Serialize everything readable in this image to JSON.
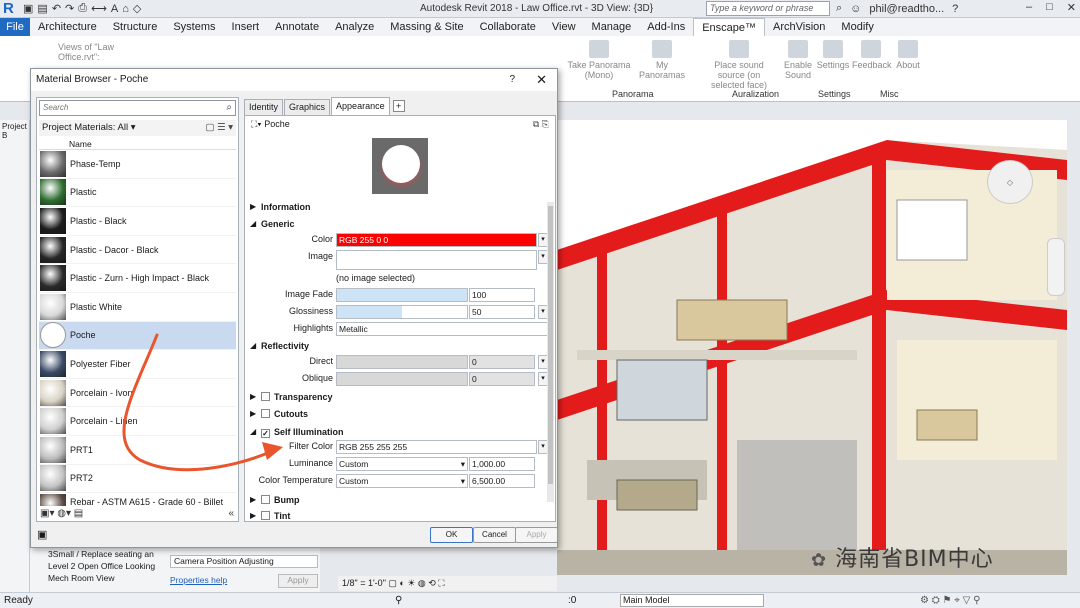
{
  "titlebar": {
    "window_title": "Autodesk Revit 2018 -    Law Office.rvt - 3D View: {3D}",
    "search_placeholder": "Type a keyword or phrase",
    "user": "phil@readtho..."
  },
  "ribbon_tabs": [
    "File",
    "Architecture",
    "Structure",
    "Systems",
    "Insert",
    "Annotate",
    "Analyze",
    "Massing & Site",
    "Collaborate",
    "View",
    "Manage",
    "Add-Ins",
    "Enscape™",
    "ArchVision",
    "Modify"
  ],
  "ribbon": {
    "views_label": "Views of \"Law Office.rvt\":",
    "buttons": [
      "Take Panorama (Mono)",
      "My Panoramas",
      "Place sound source (on selected face)",
      "Enable Sound",
      "Settings",
      "Feedback",
      "About"
    ],
    "panels": [
      "Panorama",
      "Auralization",
      "Settings",
      "Misc"
    ]
  },
  "dialog": {
    "title": "Material Browser - Poche",
    "help": "?",
    "close": "✕",
    "search_placeholder": "Search",
    "library_filter": "Project Materials: All",
    "column_name": "Name",
    "materials": [
      {
        "name": "Phase-Temp",
        "swatch": "#6b6b6b"
      },
      {
        "name": "Plastic",
        "swatch": "#2f6e32"
      },
      {
        "name": "Plastic - Black",
        "swatch": "#1c1c1c"
      },
      {
        "name": "Plastic - Dacor - Black",
        "swatch": "#262626"
      },
      {
        "name": "Plastic - Zurn - High Impact - Black",
        "swatch": "#2a2a2a"
      },
      {
        "name": "Plastic White",
        "swatch": "#d8d8d8"
      },
      {
        "name": "Poche",
        "swatch": "#ffffff",
        "selected": true
      },
      {
        "name": "Polyester Fiber",
        "swatch": "#3a4a66"
      },
      {
        "name": "Porcelain - Ivory",
        "swatch": "#d8d3c4"
      },
      {
        "name": "Porcelain - Linen",
        "swatch": "#cfcfcf"
      },
      {
        "name": "PRT1",
        "swatch": "#bdbdbd"
      },
      {
        "name": "PRT2",
        "swatch": "#c4c4c4"
      },
      {
        "name": "Rebar - ASTM A615 - Grade 60 - Billet Steel",
        "swatch": "#5a4a44"
      }
    ],
    "tabs": [
      "Identity",
      "Graphics",
      "Appearance"
    ],
    "asset_name": "Poche",
    "sections": {
      "information": "Information",
      "generic": "Generic",
      "reflectivity": "Reflectivity",
      "transparency": "Transparency",
      "cutouts": "Cutouts",
      "self_illumination": "Self Illumination",
      "bump": "Bump",
      "tint": "Tint"
    },
    "props": {
      "color_label": "Color",
      "color_value": "RGB 255 0 0",
      "color_hex": "#ff0000",
      "image_label": "Image",
      "image_value": "(no image selected)",
      "image_fade_label": "Image Fade",
      "image_fade_value": "100",
      "glossiness_label": "Glossiness",
      "glossiness_value": "50",
      "highlights_label": "Highlights",
      "highlights_value": "Metallic",
      "direct_label": "Direct",
      "direct_value": "0",
      "oblique_label": "Oblique",
      "oblique_value": "0",
      "filter_color_label": "Filter Color",
      "filter_color_value": "RGB 255 255 255",
      "luminance_label": "Luminance",
      "luminance_mode": "Custom",
      "luminance_value": "1,000.00",
      "color_temp_label": "Color Temperature",
      "color_temp_mode": "Custom",
      "color_temp_value": "6,500.00"
    },
    "ok": "OK",
    "cancel": "Cancel",
    "apply": "Apply"
  },
  "properties_panel": {
    "rows": [
      "Camera Position   Adjusting",
      "Properties help",
      "Apply"
    ],
    "browser_items": [
      "3Small / Replace seating an",
      "Level 2 Open Office Looking",
      "Mech Room View"
    ],
    "project_browser_label": "Project B"
  },
  "view_controls": {
    "scale": "1/8\" = 1'-0\""
  },
  "status": {
    "left": "Ready",
    "model": "Main Model",
    "selection_count": ":0"
  },
  "watermark": "海南省BIM中心"
}
